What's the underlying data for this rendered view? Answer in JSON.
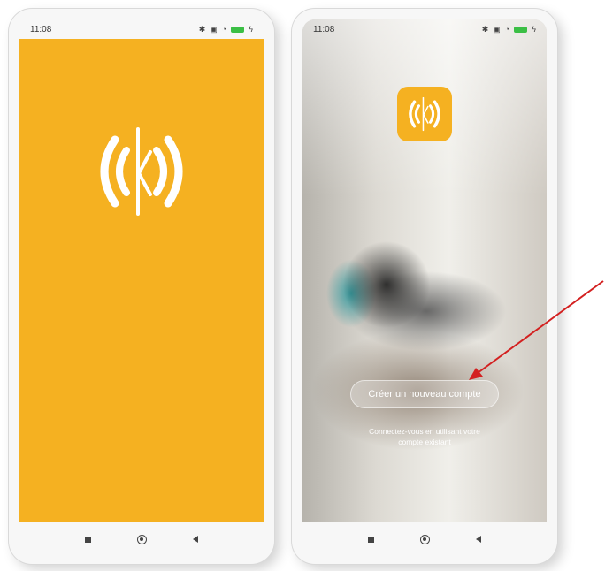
{
  "statusbar": {
    "time": "11:08",
    "icons": [
      "bluetooth-icon",
      "sim-icon",
      "wifi-icon",
      "battery-icon"
    ]
  },
  "phone2": {
    "create_account_label": "Créer un nouveau compte",
    "login_text_line1": "Connectez-vous en utilisant votre",
    "login_text_line2": "compte existant"
  },
  "navbar": {
    "items": [
      "recent-apps-icon",
      "home-icon",
      "back-icon"
    ]
  },
  "colors": {
    "brand": "#f5b121",
    "annotation_arrow": "#d32020"
  }
}
